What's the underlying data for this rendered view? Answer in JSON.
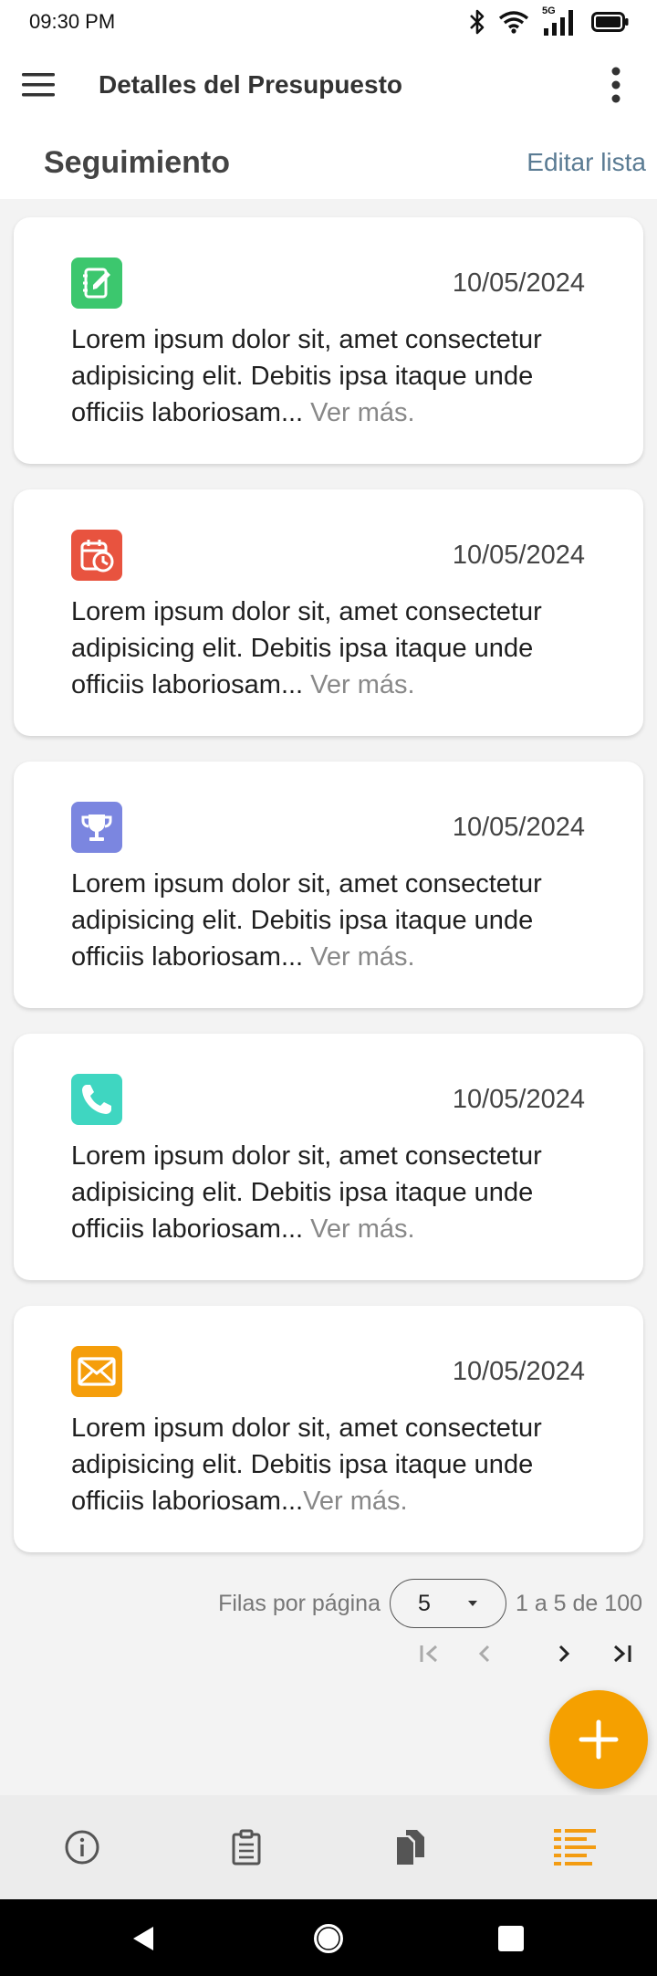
{
  "status_bar": {
    "time": "09:30 PM",
    "network": "5G"
  },
  "app_bar": {
    "title": "Detalles del Presupuesto"
  },
  "section": {
    "title": "Seguimiento",
    "edit_label": "Editar lista"
  },
  "cards": [
    {
      "icon": "notebook-edit-icon",
      "color": "#3cc76e",
      "date": "10/05/2024",
      "text": "Lorem ipsum dolor sit, amet consectetur adipisicing elit. Debitis ipsa itaque unde officiis laboriosam...",
      "more": " Ver más."
    },
    {
      "icon": "calendar-clock-icon",
      "color": "#e8533f",
      "date": "10/05/2024",
      "text": "Lorem ipsum dolor sit, amet consectetur adipisicing elit. Debitis ipsa itaque unde officiis laboriosam...",
      "more": " Ver más."
    },
    {
      "icon": "trophy-icon",
      "color": "#7b86e0",
      "date": "10/05/2024",
      "text": "Lorem ipsum dolor sit, amet consectetur adipisicing elit. Debitis ipsa itaque unde officiis laboriosam...",
      "more": " Ver más."
    },
    {
      "icon": "phone-icon",
      "color": "#3fd6c1",
      "date": "10/05/2024",
      "text": "Lorem ipsum dolor sit, amet consectetur adipisicing elit. Debitis ipsa itaque unde officiis laboriosam...",
      "more": " Ver más."
    },
    {
      "icon": "mail-icon",
      "color": "#f59e0b",
      "date": "10/05/2024",
      "text": "Lorem ipsum dolor sit, amet consectetur adipisicing elit. Debitis ipsa itaque unde officiis laboriosam...",
      "more": "Ver más."
    }
  ],
  "pagination": {
    "rows_label": "Filas por página",
    "rows_value": "5",
    "range_label": "1 a 5 de 100"
  },
  "fab": {
    "icon": "plus-icon",
    "color": "#f5a000"
  },
  "bottom_nav": {
    "items": [
      "info-icon",
      "clipboard-icon",
      "copy-icon",
      "list-icon"
    ],
    "active": "list-icon",
    "active_color": "#f39c12"
  }
}
